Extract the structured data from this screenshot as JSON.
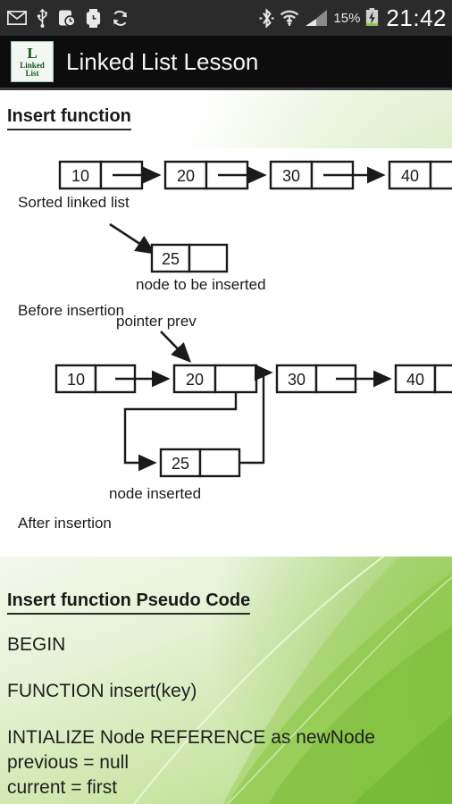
{
  "statusbar": {
    "left_icons": [
      "email-icon",
      "usb-icon",
      "alarm-clock-icon",
      "watch-icon",
      "sync-icon"
    ],
    "right_icons": [
      "bluetooth-icon",
      "wifi-icon",
      "cell-signal-icon",
      "battery-charging-icon"
    ],
    "battery": "15%",
    "clock": "21:42"
  },
  "actionbar": {
    "app_icon": {
      "letter": "L",
      "line1": "Linked",
      "line2": "List"
    },
    "title": "Linked List Lesson"
  },
  "sections": {
    "insert_heading": "Insert function",
    "pseudo_heading": "Insert function Pseudo Code"
  },
  "diagram": {
    "alt": "linked-list-insert-diagram",
    "top_nodes": [
      "10",
      "20",
      "30",
      "40"
    ],
    "new_node": "25",
    "bottom_nodes": [
      "10",
      "20",
      "30",
      "40"
    ],
    "inserted_node": "25",
    "labels": {
      "sorted": "Sorted linked list",
      "to_be_inserted": "node to be inserted",
      "before": "Before insertion",
      "pointer_prev": "pointer prev",
      "node_inserted": "node inserted",
      "after": "After insertion"
    }
  },
  "pseudocode": {
    "lines": [
      "BEGIN",
      "FUNCTION insert(key)",
      "INTIALIZE Node REFERENCE as newNode",
      "previous = null",
      "current = first"
    ]
  },
  "colors": {
    "statusbar_bg": "#2b2b2b",
    "actionbar_bg": "#0d0d0d",
    "accent_green": "#7fc13a",
    "battery_green": "#8bc34a",
    "icon_brand": "#14561f"
  }
}
